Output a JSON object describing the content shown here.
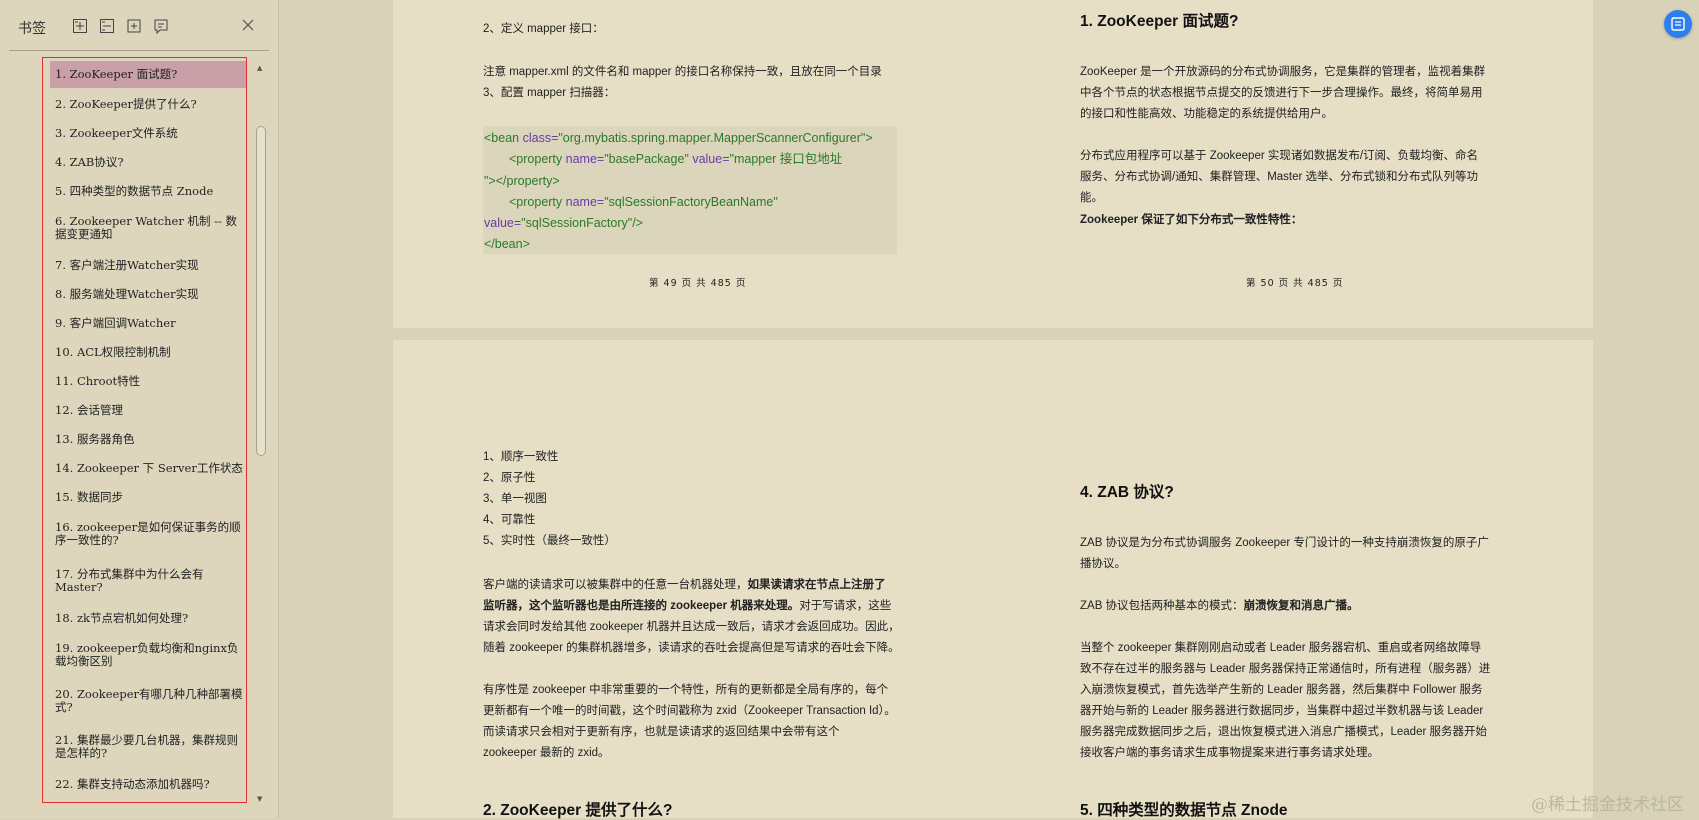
{
  "sidebar": {
    "title": "书签",
    "toolbar_icons": [
      "expand-all-icon",
      "collapse-all-icon",
      "add-bookmark-icon",
      "bookmark-settings-icon"
    ],
    "items": [
      {
        "label": "1. ZooKeeper 面试题?"
      },
      {
        "label": "2. ZooKeeper提供了什么?"
      },
      {
        "label": "3. Zookeeper文件系统"
      },
      {
        "label": "4. ZAB协议?"
      },
      {
        "label": "5. 四种类型的数据节点 Znode"
      },
      {
        "label": "6. Zookeeper Watcher 机制 -- 数据变更通知"
      },
      {
        "label": "7. 客户端注册Watcher实现"
      },
      {
        "label": "8. 服务端处理Watcher实现"
      },
      {
        "label": "9. 客户端回调Watcher"
      },
      {
        "label": "10. ACL权限控制机制"
      },
      {
        "label": "11. Chroot特性"
      },
      {
        "label": "12. 会话管理"
      },
      {
        "label": "13. 服务器角色"
      },
      {
        "label": "14. Zookeeper 下 Server工作状态"
      },
      {
        "label": "15. 数据同步"
      },
      {
        "label": "16. zookeeper是如何保证事务的顺序一致性的?"
      },
      {
        "label": "17. 分布式集群中为什么会有Master?"
      },
      {
        "label": "18. zk节点宕机如何处理?"
      },
      {
        "label": "19. zookeeper负载均衡和nginx负载均衡区别"
      },
      {
        "label": "20. Zookeeper有哪几种几种部署模式?"
      },
      {
        "label": "21. 集群最少要几台机器，集群规则是怎样的?"
      },
      {
        "label": "22. 集群支持动态添加机器吗?"
      }
    ]
  },
  "pages": {
    "p49": {
      "line1": "2、定义 mapper 接口：",
      "line2": "注意 mapper.xml 的文件名和 mapper 的接口名称保持一致，且放在同一个目录",
      "line3": "3、配置 mapper 扫描器：",
      "code": {
        "l1_open": "<bean ",
        "l1_attr": "class=",
        "l1_val": "\"org.mybatis.spring.mapper.MapperScannerConfigurer\"",
        "l1_close": ">",
        "l2_open": "<property ",
        "l2_attr1": "name=",
        "l2_val1": "\"basePackage\" ",
        "l2_attr2": "value=",
        "l2_val2": "\"mapper 接口包地址",
        "l3": "\"></property>",
        "l4_open": "<property ",
        "l4_attr": "name=",
        "l4_val": "\"sqlSessionFactoryBeanName\"",
        "l5_attr": "value=",
        "l5_val": "\"sqlSessionFactory\"",
        "l5_close": "/>",
        "l6": "</bean>"
      },
      "footer": "第 49 页 共 485 页"
    },
    "p50": {
      "heading": "1. ZooKeeper 面试题?",
      "para1": [
        "ZooKeeper 是一个开放源码的分布式协调服务，它是集群的管理者，监视着集群",
        "中各个节点的状态根据节点提交的反馈进行下一步合理操作。最终，将简单易用",
        "的接口和性能高效、功能稳定的系统提供给用户。"
      ],
      "para2": [
        "分布式应用程序可以基于 Zookeeper 实现诸如数据发布/订阅、负载均衡、命名",
        "服务、分布式协调/通知、集群管理、Master 选举、分布式锁和分布式队列等功能。"
      ],
      "para3": "Zookeeper 保证了如下分布式一致性特性：",
      "footer": "第 50 页 共 485 页"
    },
    "p51": {
      "list": [
        "1、顺序一致性",
        "2、原子性",
        "3、单一视图",
        "4、可靠性",
        "5、实时性（最终一致性）"
      ],
      "para1_a": "客户端的读请求可以被集群中的任意一台机器处理，",
      "para1_b": "如果读请求在节点上注册了",
      "para1_c": "监听器，这个监听器也是由所连接的 zookeeper 机器来处理。",
      "para1_d": "对于写请求，这些",
      "para1_e": "请求会同时发给其他 zookeeper 机器并且达成一致后，请求才会返回成功。因此，",
      "para1_f": "随着 zookeeper 的集群机器增多，读请求的吞吐会提高但是写请求的吞吐会下降。",
      "para2": [
        "有序性是 zookeeper 中非常重要的一个特性，所有的更新都是全局有序的，每个",
        "更新都有一个唯一的时间戳，这个时间戳称为 zxid（Zookeeper Transaction Id）。",
        "而读请求只会相对于更新有序，也就是读请求的返回结果中会带有这个",
        "zookeeper 最新的 zxid。"
      ],
      "heading": "2. ZooKeeper 提供了什么?"
    },
    "p52": {
      "heading": "4. ZAB 协议?",
      "para1": [
        "ZAB 协议是为分布式协调服务 Zookeeper 专门设计的一种支持崩溃恢复的原子广",
        "播协议。"
      ],
      "para2_a": "ZAB 协议包括两种基本的模式：",
      "para2_b": "崩溃恢复和消息广播。",
      "para3": [
        "当整个 zookeeper 集群刚刚启动或者 Leader 服务器宕机、重启或者网络故障导",
        "致不存在过半的服务器与 Leader 服务器保持正常通信时，所有进程（服务器）进",
        "入崩溃恢复模式，首先选举产生新的 Leader 服务器，然后集群中 Follower 服务",
        "器开始与新的 Leader 服务器进行数据同步，当集群中超过半数机器与该 Leader",
        "服务器完成数据同步之后，退出恢复模式进入消息广播模式，Leader 服务器开始",
        "接收客户端的事务请求生成事物提案来进行事务请求处理。"
      ],
      "heading2": "5. 四种类型的数据节点 Znode"
    }
  },
  "watermark": "@稀土掘金技术社区",
  "colors": {
    "active_item": "#c9a0a8",
    "frame_border": "#e03030",
    "float_button": "#2d7ff0",
    "page_bg": "#e6dfc6"
  }
}
